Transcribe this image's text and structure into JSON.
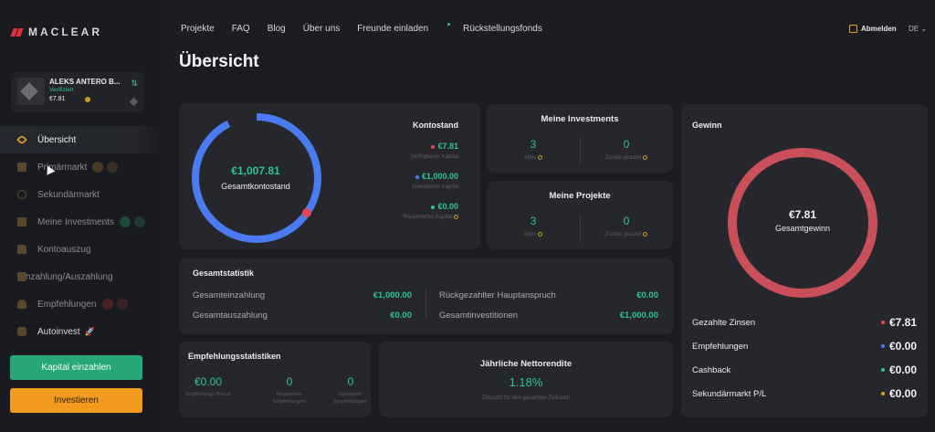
{
  "brand": {
    "name": "MACLEAR"
  },
  "account": {
    "name": "ALEKS ANTERO B...",
    "status": "Verifiziert",
    "balance": "€7.81"
  },
  "sidebar": {
    "items": [
      {
        "label": "Übersicht",
        "icon": "eye-icon",
        "active": true
      },
      {
        "label": "Primärmarkt",
        "icon": "box-icon",
        "badge_colors": [
          "#4a3a22",
          "#4a3a22"
        ]
      },
      {
        "label": "Sekundärmarkt",
        "icon": "clock-icon"
      },
      {
        "label": "Meine Investments",
        "icon": "wallet-icon",
        "badge_colors": [
          "#1e4a3a",
          "#1e4a3a"
        ]
      },
      {
        "label": "Kontoauszug",
        "icon": "folder-icon"
      },
      {
        "label": "Einzahlung/Auszahlung",
        "icon": "card-icon"
      },
      {
        "label": "Empfehlungen",
        "icon": "people-icon",
        "badge_colors": [
          "#4a2226",
          "#4a2226"
        ]
      },
      {
        "label": "Autoinvest",
        "icon": "bot-icon"
      }
    ],
    "deposit_button": "Kapital einzahlen",
    "invest_button": "Investieren"
  },
  "topnav": {
    "links": [
      "Projekte",
      "FAQ",
      "Blog",
      "Über uns",
      "Freunde einladen",
      "Rückstellungsfonds"
    ],
    "logout": "Abmelden",
    "language": "DE"
  },
  "page": {
    "title": "Übersicht"
  },
  "kontostand": {
    "title": "Kontostand",
    "total": "€1,007.81",
    "total_label": "Gesamtkontostand",
    "rows": [
      {
        "value": "€7.81",
        "label": "Verfügbares Kapital",
        "color": "#e04a56"
      },
      {
        "value": "€1,000.00",
        "label": "Investiertes Kapital",
        "color": "#4a7bf0"
      },
      {
        "value": "€0.00",
        "label": "Reserviertes Kapital",
        "color": "#2fc38f"
      }
    ]
  },
  "meine_investments": {
    "title": "Meine Investments",
    "left": {
      "value": "3",
      "label": "Aktiv"
    },
    "right": {
      "value": "0",
      "label": "Zurück gezahlt"
    }
  },
  "meine_projekte": {
    "title": "Meine Projekte",
    "left": {
      "value": "3",
      "label": "Aktiv"
    },
    "right": {
      "value": "0",
      "label": "Zurück gezahlt"
    }
  },
  "gewinn": {
    "title": "Gewinn",
    "total": "€7.81",
    "total_label": "Gesamtgewinn",
    "rows": [
      {
        "label": "Gezahlte Zinsen",
        "value": "€7.81",
        "color": "#e04a56"
      },
      {
        "label": "Empfehlungen",
        "value": "€0.00",
        "color": "#4a7bf0"
      },
      {
        "label": "Cashback",
        "value": "€0.00",
        "color": "#2fc38f"
      },
      {
        "label": "Sekundärmarkt P/L",
        "value": "€0.00",
        "color": "#f29a1e"
      }
    ]
  },
  "gesamtstatistik": {
    "title": "Gesamtstatistik",
    "left": [
      {
        "label": "Gesamteinzahlung",
        "value": "€1,000.00"
      },
      {
        "label": "Gesamtauszahlung",
        "value": "€0.00"
      }
    ],
    "right": [
      {
        "label": "Rückgezahlter Hauptanspruch",
        "value": "€0.00"
      },
      {
        "label": "Gesamtinvestitionen",
        "value": "€1,000.00"
      }
    ]
  },
  "empfehlungsstatistiken": {
    "title": "Empfehlungsstatistiken",
    "cols": [
      {
        "value": "€0.00",
        "label": "Empfehlungs Bonus"
      },
      {
        "value": "0",
        "label": "Registrierte Empfehlungen"
      },
      {
        "value": "0",
        "label": "Investierte Empfehlungen"
      }
    ]
  },
  "jaehrliche_rendite": {
    "title": "Jährliche Nettorendite",
    "value": "1.18%",
    "note": "Zinssatz für den gesamten Zeitraum"
  },
  "colors": {
    "accent_green": "#2fc38f",
    "accent_orange": "#f29a1e",
    "ring_blue": "#4a7bf0",
    "ring_red": "#c9505a"
  },
  "kontostand_ring_fraction": 0.992
}
